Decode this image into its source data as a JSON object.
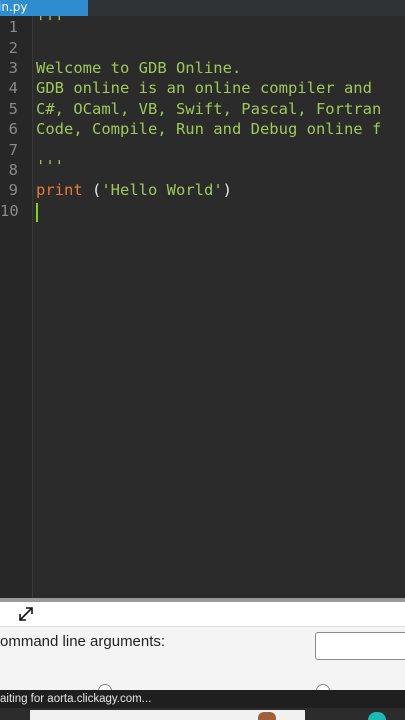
{
  "editor": {
    "tab_label": "in.py",
    "line_numbers": [
      "1",
      "2",
      "3",
      "4",
      "5",
      "6",
      "7",
      "8",
      "9",
      "10"
    ],
    "lines": [
      "'''",
      "",
      "Welcome to GDB Online.",
      "GDB online is an online compiler and",
      "C#, OCaml, VB, Swift, Pascal, Fortran",
      "Code, Compile, Run and Debug online f",
      "",
      "'''",
      "",
      ""
    ],
    "print_line": {
      "keyword": "print",
      "open_paren": " (",
      "string": "'Hello World'",
      "close_paren": ")"
    },
    "colors": {
      "background": "#2b2b2b",
      "comment_string": "#9fc85a",
      "keyword": "#e57a3a",
      "cursor": "#7ed321"
    }
  },
  "panel": {
    "cli_label": "ommand line arguments:",
    "cli_value": ""
  },
  "statusbar": {
    "text": "aiting for aorta.clickagy.com..."
  }
}
